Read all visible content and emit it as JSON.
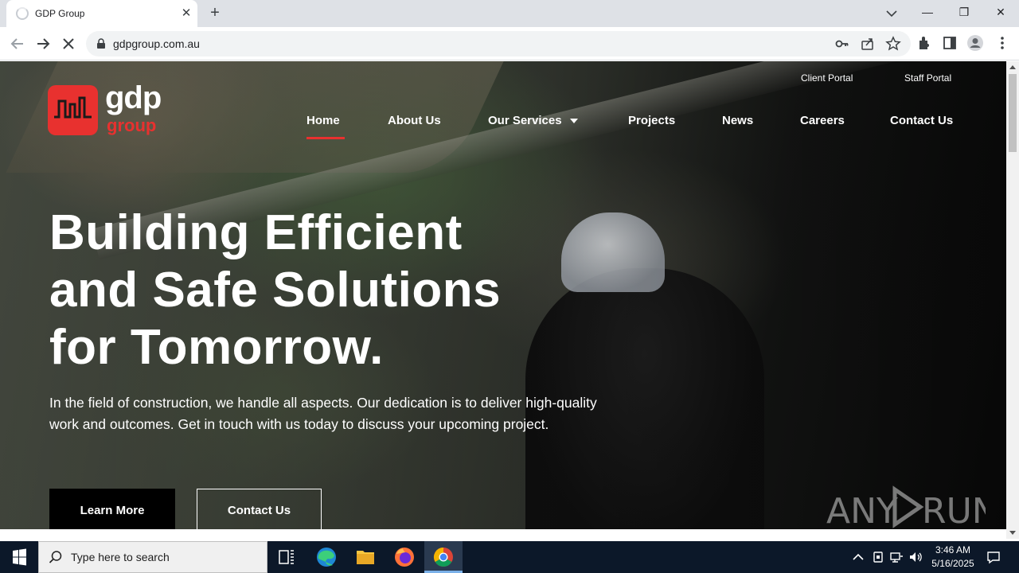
{
  "browser": {
    "tab_title": "GDP Group",
    "url": "gdpgroup.com.au"
  },
  "site": {
    "logo": {
      "word": "gdp",
      "sub": "group"
    },
    "top_links": [
      "Client Portal",
      "Staff Portal"
    ],
    "nav": [
      {
        "label": "Home",
        "active": true
      },
      {
        "label": "About Us"
      },
      {
        "label": "Our Services",
        "has_dropdown": true
      },
      {
        "label": "Projects"
      },
      {
        "label": "News"
      },
      {
        "label": "Careers"
      },
      {
        "label": "Contact Us"
      }
    ],
    "hero": {
      "title_lines": [
        "Building Efficient",
        "and Safe Solutions",
        "for Tomorrow."
      ],
      "text": "In the field of construction, we handle all aspects. Our dedication is to deliver high-quality work and outcomes. Get in touch with us today to discuss your upcoming project.",
      "btn_primary": "Learn More",
      "btn_secondary": "Contact Us"
    },
    "watermark": "ANY RUN",
    "accent_color": "#e8312f"
  },
  "taskbar": {
    "search_placeholder": "Type here to search",
    "time": "3:46 AM",
    "date": "5/16/2025"
  }
}
